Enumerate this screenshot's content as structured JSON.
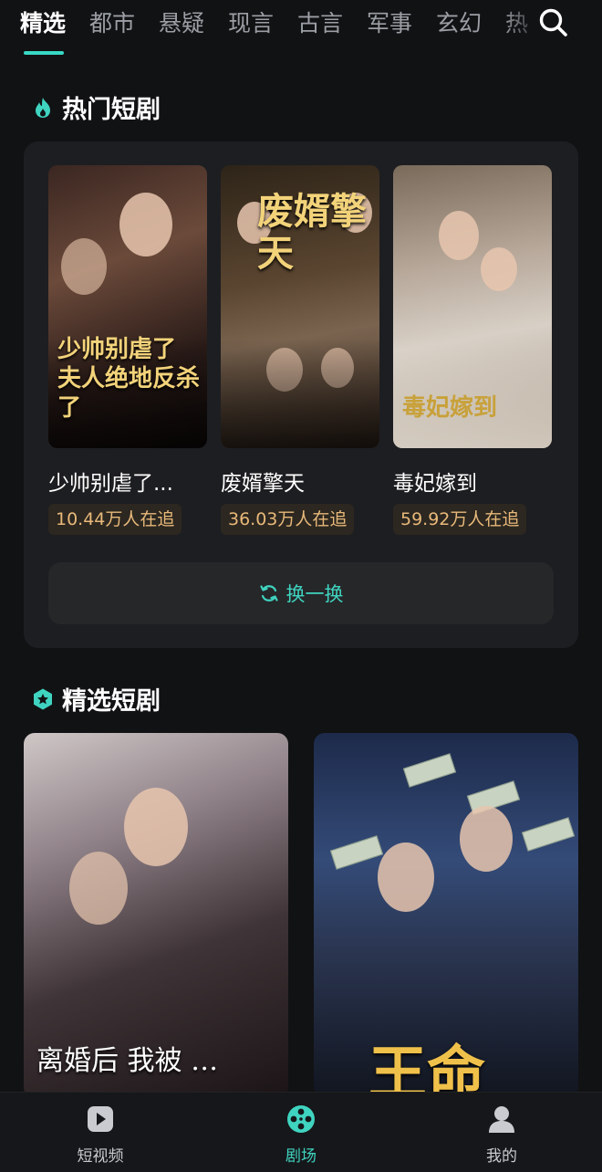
{
  "tabs": [
    {
      "label": "精选",
      "active": true
    },
    {
      "label": "都市"
    },
    {
      "label": "悬疑"
    },
    {
      "label": "现言"
    },
    {
      "label": "古言"
    },
    {
      "label": "军事"
    },
    {
      "label": "玄幻"
    },
    {
      "label": "热"
    }
  ],
  "icons": {
    "search": "search-icon",
    "hot": "flame-icon",
    "featured": "star-badge-icon",
    "refresh": "refresh-icon"
  },
  "hot_section": {
    "title": "热门短剧",
    "items": [
      {
        "name": "少帅别虐了...",
        "poster_text": "少帅别虐了 夫人绝地反杀了",
        "followers": "10.44万人在追"
      },
      {
        "name": "废婿擎天",
        "poster_text": "废婿擎天",
        "followers": "36.03万人在追"
      },
      {
        "name": "毒妃嫁到",
        "poster_text": "毒妃嫁到",
        "followers": "59.92万人在追"
      }
    ],
    "refresh_label": "换一换"
  },
  "featured_section": {
    "title": "精选短剧",
    "items": [
      {
        "poster_text": "离婚后 我被 …"
      },
      {
        "poster_text": "王命"
      }
    ]
  },
  "bottom_nav": [
    {
      "label": "短视频",
      "icon": "play-icon"
    },
    {
      "label": "剧场",
      "icon": "film-reel-icon",
      "active": true
    },
    {
      "label": "我的",
      "icon": "user-icon"
    }
  ],
  "colors": {
    "accent": "#3fd4c0",
    "background": "#111214",
    "card": "#1d1e21",
    "badge_text": "#e8b97a"
  }
}
